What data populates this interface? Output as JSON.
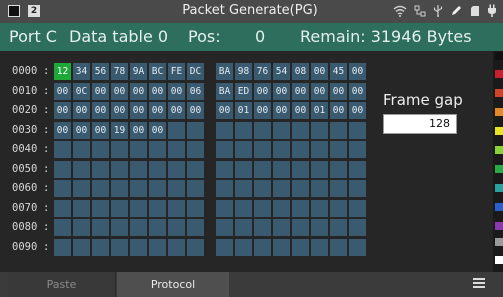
{
  "status_bar": {
    "title": "Packet Generate(PG)",
    "badge_number": "2",
    "icons": [
      "wifi-icon",
      "network-icon",
      "usb-icon",
      "pencil-icon",
      "sd-card-icon",
      "power-plug-icon"
    ]
  },
  "info": {
    "port": "Port C",
    "data_table": "Data table 0",
    "pos_label": "Pos:",
    "pos_value": "0",
    "remain": "Remain: 31946 Bytes"
  },
  "hex_table": {
    "selected_row": 0,
    "selected_col": 0,
    "rows": [
      {
        "address": "0000",
        "bytes": [
          "12",
          "34",
          "56",
          "78",
          "9A",
          "BC",
          "FE",
          "DC",
          "BA",
          "98",
          "76",
          "54",
          "08",
          "00",
          "45",
          "00"
        ]
      },
      {
        "address": "0010",
        "bytes": [
          "00",
          "0C",
          "00",
          "00",
          "00",
          "00",
          "00",
          "06",
          "BA",
          "ED",
          "00",
          "00",
          "00",
          "00",
          "00",
          "00"
        ]
      },
      {
        "address": "0020",
        "bytes": [
          "00",
          "00",
          "00",
          "00",
          "00",
          "00",
          "00",
          "00",
          "00",
          "01",
          "00",
          "00",
          "00",
          "01",
          "00",
          "00"
        ]
      },
      {
        "address": "0030",
        "bytes": [
          "00",
          "00",
          "00",
          "19",
          "00",
          "00",
          "",
          "",
          "",
          "",
          "",
          "",
          "",
          "",
          "",
          ""
        ]
      },
      {
        "address": "0040",
        "bytes": [
          "",
          "",
          "",
          "",
          "",
          "",
          "",
          "",
          "",
          "",
          "",
          "",
          "",
          "",
          "",
          ""
        ]
      },
      {
        "address": "0050",
        "bytes": [
          "",
          "",
          "",
          "",
          "",
          "",
          "",
          "",
          "",
          "",
          "",
          "",
          "",
          "",
          "",
          ""
        ]
      },
      {
        "address": "0060",
        "bytes": [
          "",
          "",
          "",
          "",
          "",
          "",
          "",
          "",
          "",
          "",
          "",
          "",
          "",
          "",
          "",
          ""
        ]
      },
      {
        "address": "0070",
        "bytes": [
          "",
          "",
          "",
          "",
          "",
          "",
          "",
          "",
          "",
          "",
          "",
          "",
          "",
          "",
          "",
          ""
        ]
      },
      {
        "address": "0080",
        "bytes": [
          "",
          "",
          "",
          "",
          "",
          "",
          "",
          "",
          "",
          "",
          "",
          "",
          "",
          "",
          "",
          ""
        ]
      },
      {
        "address": "0090",
        "bytes": [
          "",
          "",
          "",
          "",
          "",
          "",
          "",
          "",
          "",
          "",
          "",
          "",
          "",
          "",
          "",
          ""
        ]
      }
    ]
  },
  "frame_gap": {
    "label": "Frame gap",
    "value": "128"
  },
  "palette_colors": [
    "#111111",
    "#c81e2d",
    "#d0452a",
    "#e08a2a",
    "#e6e32a",
    "#8ad13a",
    "#2aa84a",
    "#2aa0a0",
    "#2a5fd0",
    "#8a3ab0",
    "#9a9a9a",
    "#ffffff"
  ],
  "bottom_bar": {
    "paste_label": "Paste",
    "protocol_label": "Protocol"
  }
}
